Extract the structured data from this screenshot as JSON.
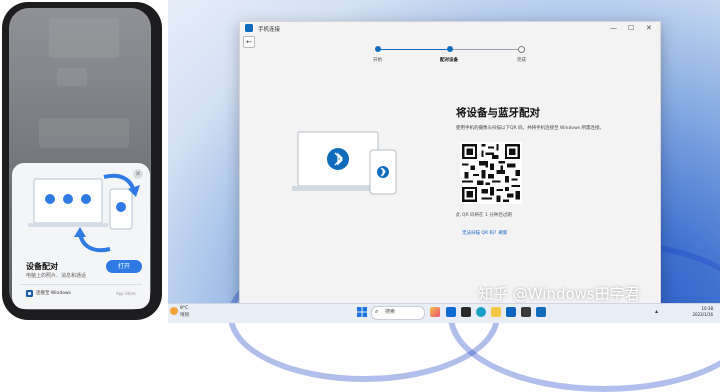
{
  "phone": {
    "sheet_title": "设备配对",
    "sheet_subtitle": "电脑上的照片、消息和通话",
    "open_button": "打开",
    "close_icon": "close-icon",
    "footer_app": "连接至 Windows",
    "footer_store": "App Store"
  },
  "window": {
    "app_title": "手机连接",
    "back_icon": "back-arrow-icon",
    "controls": {
      "minimize": "—",
      "maximize": "☐",
      "close": "✕"
    },
    "steps": [
      {
        "label": "开始",
        "state": "done"
      },
      {
        "label": "配对设备",
        "state": "current"
      },
      {
        "label": "完成",
        "state": "pending"
      }
    ],
    "heading": "将设备与蓝牙配对",
    "description": "使用手机的摄像头扫描以下QR 码，并将手机连接至 Windows 所需连接。",
    "qr_note": "此 QR 码将在 1 分钟后过期",
    "qr_link": "无法扫描 QR 码？刷新",
    "accent": "#0f6cbd",
    "bluetooth_icon": "bluetooth-icon"
  },
  "watermark": "知乎 @Windows田字君",
  "taskbar": {
    "weather_temp": "9°C",
    "weather_cond": "晴朗",
    "search_placeholder": "搜索",
    "clock": "10:38",
    "date": "2023/1/16"
  }
}
